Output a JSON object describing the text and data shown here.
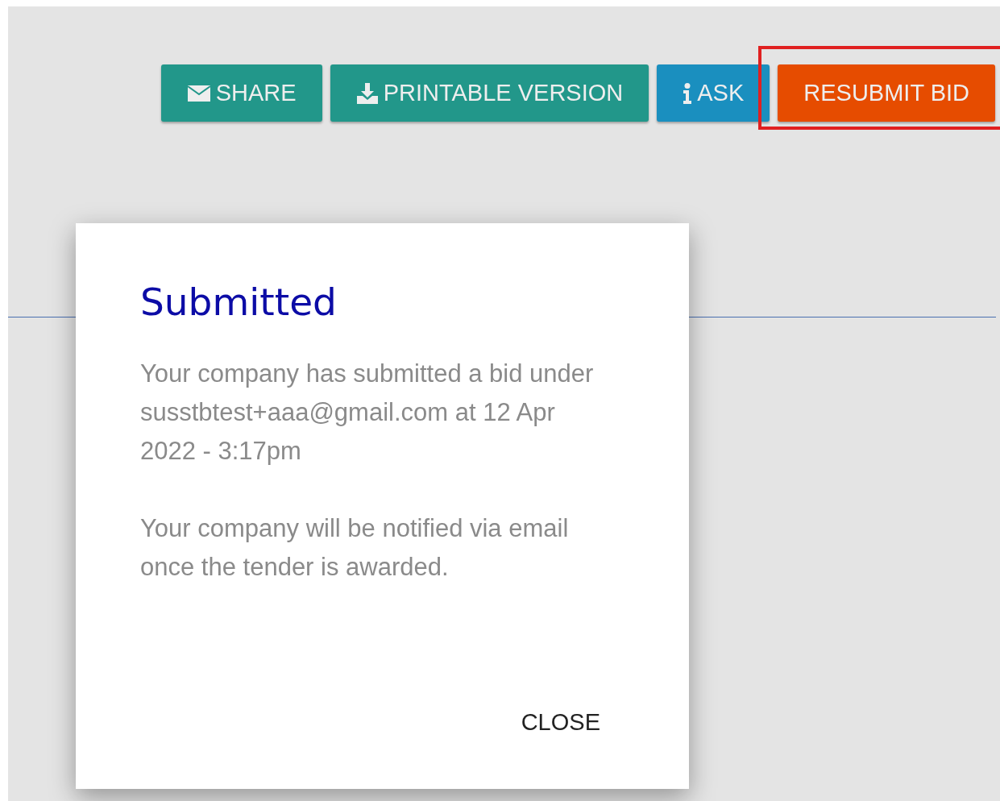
{
  "toolbar": [
    {
      "label": "SHARE",
      "kind": "teal",
      "highlighted": false
    },
    {
      "label": "PRINTABLE VERSION",
      "kind": "teal",
      "highlighted": false
    },
    {
      "label": "ASK",
      "kind": "blue",
      "highlighted": false
    },
    {
      "label": "RESUBMIT BID",
      "kind": "orange",
      "highlighted": true
    }
  ],
  "dialog": {
    "title": "Submitted",
    "paragraphs": [
      "Your company has submitted a bid under susstbtest+aaa@gmail.com at 12 Apr 2022 - 3:17pm",
      "Your company will be notified via email once the tender is awarded."
    ],
    "close": "CLOSE"
  }
}
